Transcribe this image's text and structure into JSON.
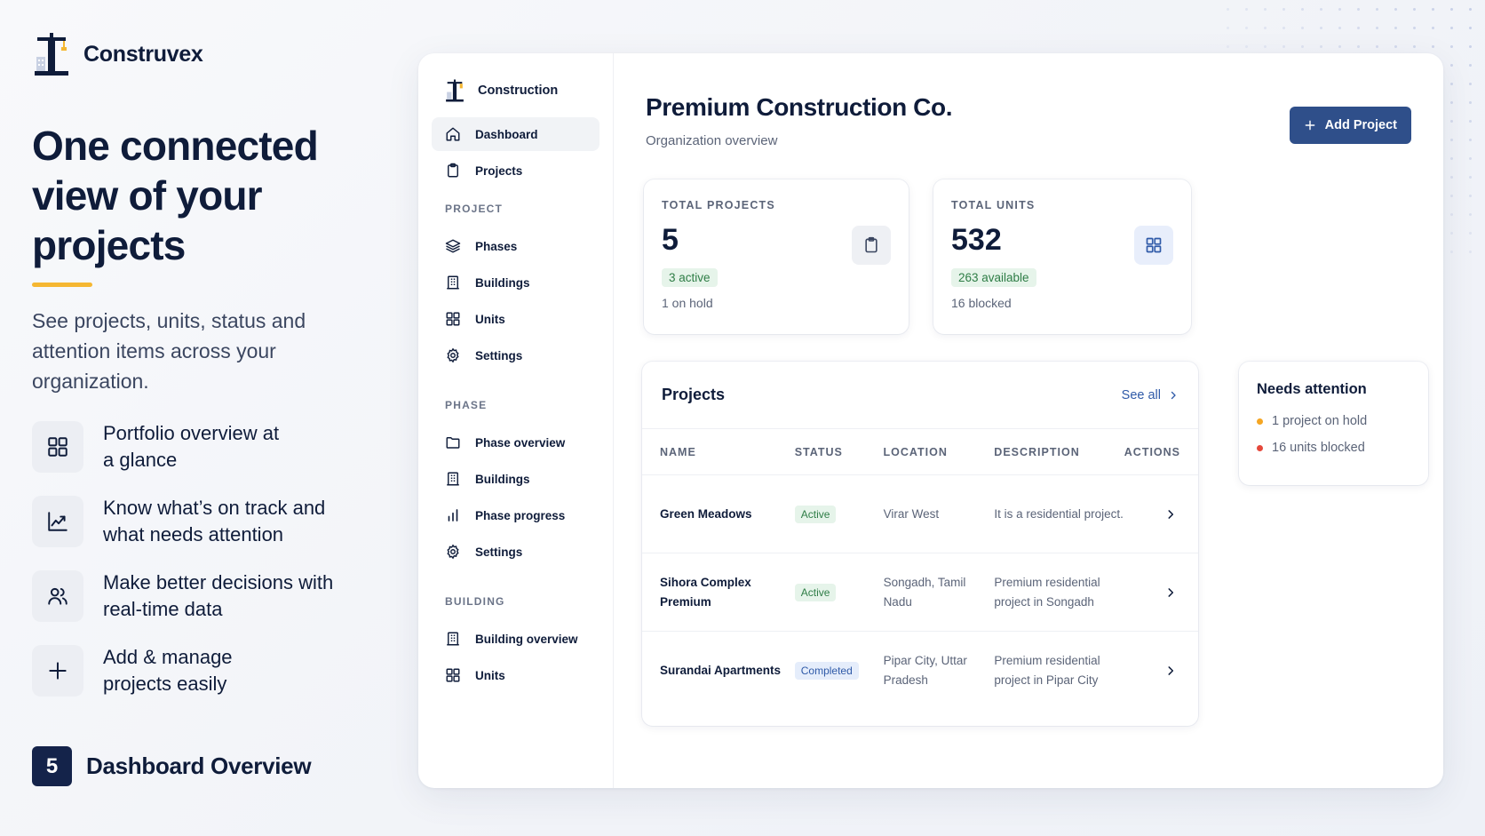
{
  "brand": {
    "name": "Construvex"
  },
  "hero": {
    "headline": "One connected view of your projects",
    "subcopy": "See projects, units, status and attention items across your organization."
  },
  "features": [
    {
      "icon": "grid-icon",
      "text": "Portfolio overview at a glance"
    },
    {
      "icon": "chart-line-icon",
      "text": "Know what’s on track and what needs attention"
    },
    {
      "icon": "users-icon",
      "text": "Make better decisions with real-time data"
    },
    {
      "icon": "plus-icon",
      "text": "Add & manage projects easily"
    }
  ],
  "step": {
    "number": "5",
    "label": "Dashboard Overview"
  },
  "sidebar": {
    "brand": "Construction",
    "top_items": [
      {
        "label": "Dashboard",
        "icon": "home-icon",
        "active": true
      },
      {
        "label": "Projects",
        "icon": "clipboard-icon",
        "active": false
      }
    ],
    "sections": [
      {
        "title": "PROJECT",
        "items": [
          {
            "label": "Phases",
            "icon": "layers-icon"
          },
          {
            "label": "Buildings",
            "icon": "building-icon"
          },
          {
            "label": "Units",
            "icon": "grid-icon"
          },
          {
            "label": "Settings",
            "icon": "gear-icon"
          }
        ]
      },
      {
        "title": "PHASE",
        "items": [
          {
            "label": "Phase overview",
            "icon": "folder-icon"
          },
          {
            "label": "Buildings",
            "icon": "building-icon"
          },
          {
            "label": "Phase progress",
            "icon": "bar-chart-icon"
          },
          {
            "label": "Settings",
            "icon": "gear-icon"
          }
        ]
      },
      {
        "title": "BUILDING",
        "items": [
          {
            "label": "Building overview",
            "icon": "building-icon"
          },
          {
            "label": "Units",
            "icon": "grid-icon"
          }
        ]
      }
    ]
  },
  "header": {
    "title": "Premium Construction Co.",
    "subtitle": "Organization overview",
    "add_button": "Add Project"
  },
  "stats": [
    {
      "label": "TOTAL PROJECTS",
      "value": "5",
      "pill": "3 active",
      "note": "1 on hold",
      "icon": "clipboard-icon"
    },
    {
      "label": "TOTAL UNITS",
      "value": "532",
      "pill": "263 available",
      "note": "16 blocked",
      "icon": "grid-icon"
    }
  ],
  "projects": {
    "title": "Projects",
    "see_all": "See all",
    "columns": [
      "NAME",
      "STATUS",
      "LOCATION",
      "DESCRIPTION",
      "ACTIONS"
    ],
    "rows": [
      {
        "name": "Green Meadows",
        "status": "Active",
        "location": "Virar West",
        "description": "It is a residential project."
      },
      {
        "name": "Sihora Complex Premium",
        "status": "Active",
        "location": "Songadh, Tamil Nadu",
        "description": "Premium residential project in Songadh"
      },
      {
        "name": "Surandai Apartments",
        "status": "Completed",
        "location": "Pipar City, Uttar Pradesh",
        "description": "Premium residential project in Pipar City"
      }
    ]
  },
  "attention": {
    "title": "Needs attention",
    "items": [
      {
        "text": "1 project on hold",
        "color": "#f5a623"
      },
      {
        "text": "16 units blocked",
        "color": "#e5483b"
      }
    ]
  },
  "colors": {
    "navy": "#0f1c3a",
    "accent_blue": "#2f4f8a",
    "highlight_yellow": "#f5b731",
    "success_green": "#2e7d46",
    "link_blue": "#2f5aa8"
  }
}
